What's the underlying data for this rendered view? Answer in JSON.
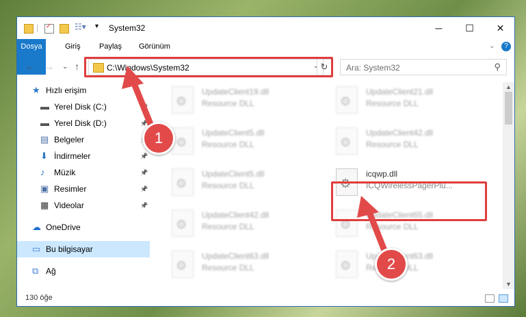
{
  "window": {
    "title": "System32",
    "controls": {
      "minimize": "─",
      "maximize": "☐",
      "close": "✕"
    }
  },
  "ribbon": {
    "tabs": [
      "Dosya",
      "Giriş",
      "Paylaş",
      "Görünüm"
    ],
    "collapse_icon": "chevron-down-icon",
    "help_icon": "help-icon"
  },
  "address": {
    "path": "C:\\Windows\\System32",
    "search_placeholder": "Ara: System32"
  },
  "sidebar": {
    "items": [
      {
        "label": "Hızlı erişim",
        "icon": "star-icon",
        "pinned": false,
        "indent": false
      },
      {
        "label": "Yerel Disk (C:)",
        "icon": "drive-icon",
        "pinned": true,
        "indent": true
      },
      {
        "label": "Yerel Disk (D:)",
        "icon": "drive-icon",
        "pinned": true,
        "indent": true
      },
      {
        "label": "Belgeler",
        "icon": "documents-icon",
        "pinned": true,
        "indent": true
      },
      {
        "label": "İndirmeler",
        "icon": "download-icon",
        "pinned": true,
        "indent": true
      },
      {
        "label": "Müzik",
        "icon": "music-icon",
        "pinned": true,
        "indent": true
      },
      {
        "label": "Resimler",
        "icon": "pictures-icon",
        "pinned": true,
        "indent": true
      },
      {
        "label": "Videolar",
        "icon": "video-icon",
        "pinned": true,
        "indent": true
      },
      {
        "label": "OneDrive",
        "icon": "cloud-icon",
        "pinned": false,
        "indent": false
      },
      {
        "label": "Bu bilgisayar",
        "icon": "computer-icon",
        "pinned": false,
        "indent": false,
        "selected": true
      },
      {
        "label": "Ağ",
        "icon": "network-icon",
        "pinned": false,
        "indent": false
      }
    ]
  },
  "files": [
    {
      "name": "UpdateClient19.dll",
      "type": "Resource DLL",
      "blurred": true
    },
    {
      "name": "UpdateClient21.dll",
      "type": "Resource DLL",
      "blurred": true
    },
    {
      "name": "UpdateClient5.dll",
      "type": "Resource DLL",
      "blurred": true
    },
    {
      "name": "UpdateClient42.dll",
      "type": "Resource DLL",
      "blurred": true
    },
    {
      "name": "UpdateClient5.dll",
      "type": "Resource DLL",
      "blurred": true
    },
    {
      "name": "icqwp.dll",
      "type": "ICQWirelessPagerPlu...",
      "blurred": false
    },
    {
      "name": "UpdateClient42.dll",
      "type": "Resource DLL",
      "blurred": true
    },
    {
      "name": "UpdateClient65.dll",
      "type": "Resource DLL",
      "blurred": true
    },
    {
      "name": "UpdateClient63.dll",
      "type": "Resource DLL",
      "blurred": true
    },
    {
      "name": "UpdateClient63.dll",
      "type": "Resource DLL",
      "blurred": true
    }
  ],
  "status": {
    "count": "130 öğe"
  },
  "callouts": {
    "one": "1",
    "two": "2"
  },
  "colors": {
    "accent": "#1979ca",
    "highlight": "#e03c3c",
    "callout": "#e24a4a",
    "selected": "#cce8ff"
  }
}
